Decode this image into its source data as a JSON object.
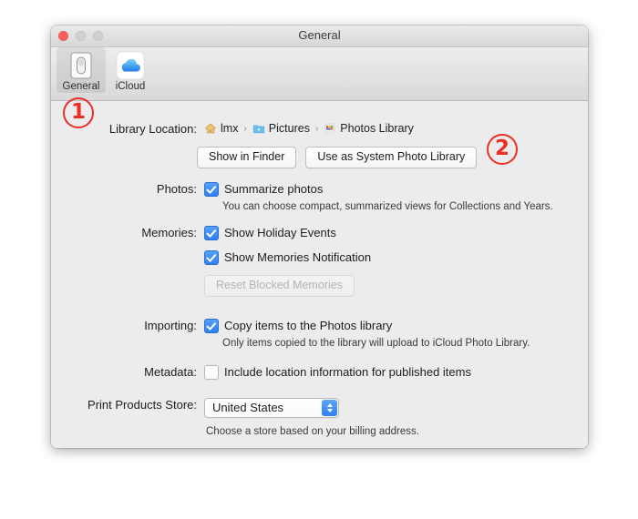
{
  "window": {
    "title": "General",
    "traffic": {
      "close": "close-button",
      "minimize": "minimize-button",
      "maximize": "maximize-button"
    }
  },
  "toolbar": {
    "items": [
      {
        "label": "General",
        "icon": "general-switch-icon",
        "selected": true
      },
      {
        "label": "iCloud",
        "icon": "icloud-cloud-icon",
        "selected": false
      }
    ]
  },
  "rows": {
    "library_location": {
      "label": "Library Location:",
      "breadcrumb": [
        {
          "text": "lmx",
          "icon": "home-icon"
        },
        {
          "text": "Pictures",
          "icon": "folder-pictures-icon"
        },
        {
          "text": "Photos Library",
          "icon": "photos-library-icon"
        }
      ],
      "separator": "›",
      "buttons": [
        {
          "label": "Show in Finder",
          "disabled": false
        },
        {
          "label": "Use as System Photo Library",
          "disabled": false
        }
      ]
    },
    "photos": {
      "label": "Photos:",
      "checkbox": {
        "text": "Summarize photos",
        "checked": true
      },
      "hint": "You can choose compact, summarized views for Collections and Years."
    },
    "memories": {
      "label": "Memories:",
      "checkboxes": [
        {
          "text": "Show Holiday Events",
          "checked": true
        },
        {
          "text": "Show Memories Notification",
          "checked": true
        }
      ],
      "button": {
        "label": "Reset Blocked Memories",
        "disabled": true
      }
    },
    "importing": {
      "label": "Importing:",
      "checkbox": {
        "text": "Copy items to the Photos library",
        "checked": true
      },
      "hint": "Only items copied to the library will upload to iCloud Photo Library."
    },
    "metadata": {
      "label": "Metadata:",
      "checkbox": {
        "text": "Include location information for published items",
        "checked": false
      }
    },
    "print_store": {
      "label": "Print Products Store:",
      "selected": "United States",
      "hint": "Choose a store based on your billing address."
    }
  },
  "annotations": [
    {
      "text": "1",
      "target": "general-toolbar-item"
    },
    {
      "text": "2",
      "target": "use-as-system-photo-library-button"
    }
  ],
  "colors": {
    "accent": "#2f7ff0",
    "annotation": "#ee2d24",
    "window_bg": "#ececec",
    "close_button": "#fc6058"
  }
}
